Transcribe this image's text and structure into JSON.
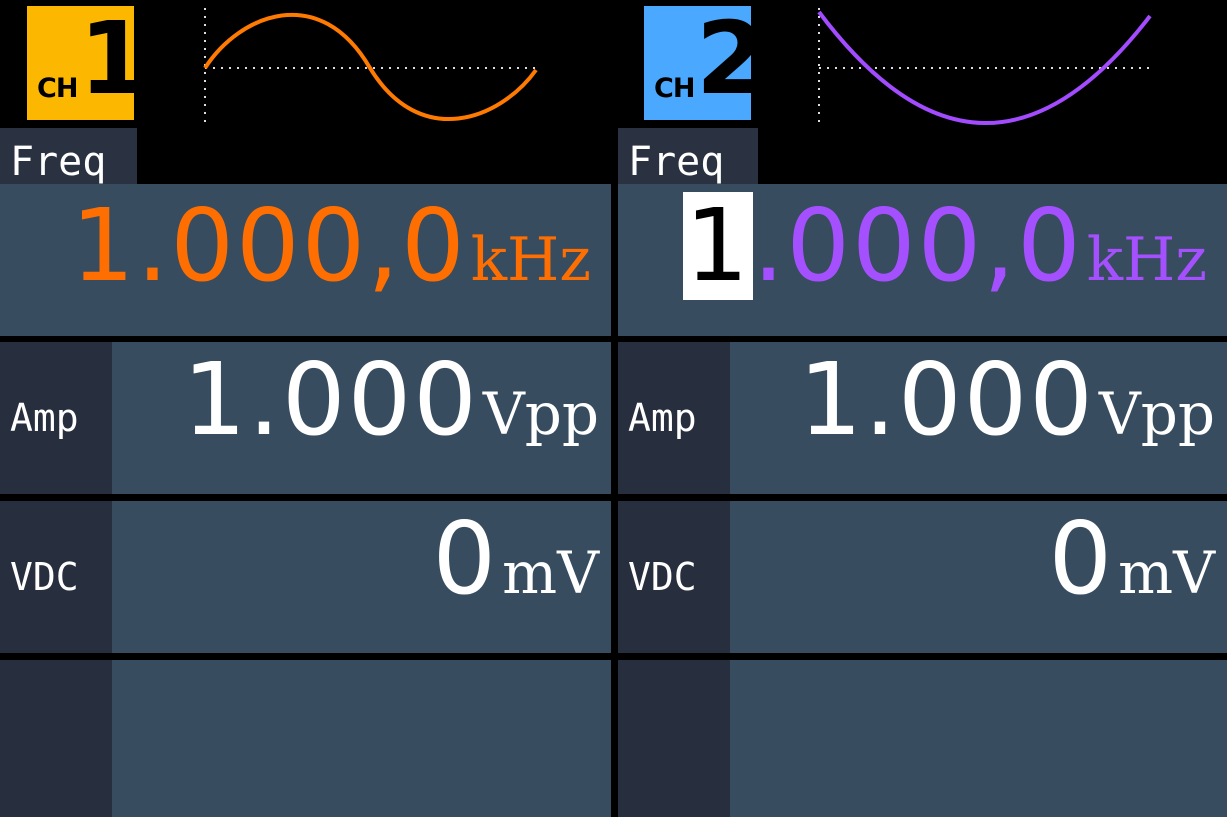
{
  "channels": [
    {
      "badge_prefix": "CH",
      "badge_number": "1",
      "badge_color": "#fcb800",
      "waveform": "sine",
      "waveform_color": "#ff7a00",
      "param_tab": "Freq",
      "freq_digits": "1.000,0",
      "freq_unit": "kHz",
      "value_color": "#ff6e00",
      "amp_label": "Amp",
      "amp_value": "1.000",
      "amp_unit": "Vpp",
      "vdc_label": "VDC",
      "vdc_value": "0",
      "vdc_unit": "mV"
    },
    {
      "badge_prefix": "CH",
      "badge_number": "2",
      "badge_color": "#4aa8ff",
      "waveform": "parabola",
      "waveform_color": "#a24bff",
      "param_tab": "Freq",
      "freq_cursor_digit": "1",
      "freq_digits_rest": ".000,0",
      "freq_unit": "kHz",
      "value_color": "#a550ff",
      "amp_label": "Amp",
      "amp_value": "1.000",
      "amp_unit": "Vpp",
      "vdc_label": "VDC",
      "vdc_value": "0",
      "vdc_unit": "mV"
    }
  ]
}
